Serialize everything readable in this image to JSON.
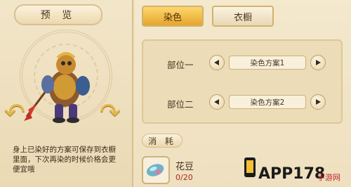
{
  "preview": {
    "title": "预 览",
    "note": "身上已染好的方案可保存到衣橱里面，下次再染的时候价格会更便宜哦"
  },
  "tabs": {
    "dye": "染色",
    "wardrobe": "衣橱"
  },
  "dye_rows": [
    {
      "label": "部位一",
      "option": "染色方案1"
    },
    {
      "label": "部位二",
      "option": "染色方案2"
    }
  ],
  "consume": {
    "header": "消 耗",
    "item_name": "花豆",
    "item_count": "0/20"
  },
  "watermark": {
    "brand": "APP178",
    "tagline": "手游网"
  },
  "colors": {
    "tab_active": "#e5a62d",
    "count_red": "#b3261e",
    "panel_bg": "#efe2c2"
  },
  "icons": {
    "rotate_left": "rotate-left-arrow-icon",
    "rotate_right": "rotate-right-arrow-icon",
    "prev": "triangle-left-icon",
    "next": "triangle-right-icon"
  }
}
